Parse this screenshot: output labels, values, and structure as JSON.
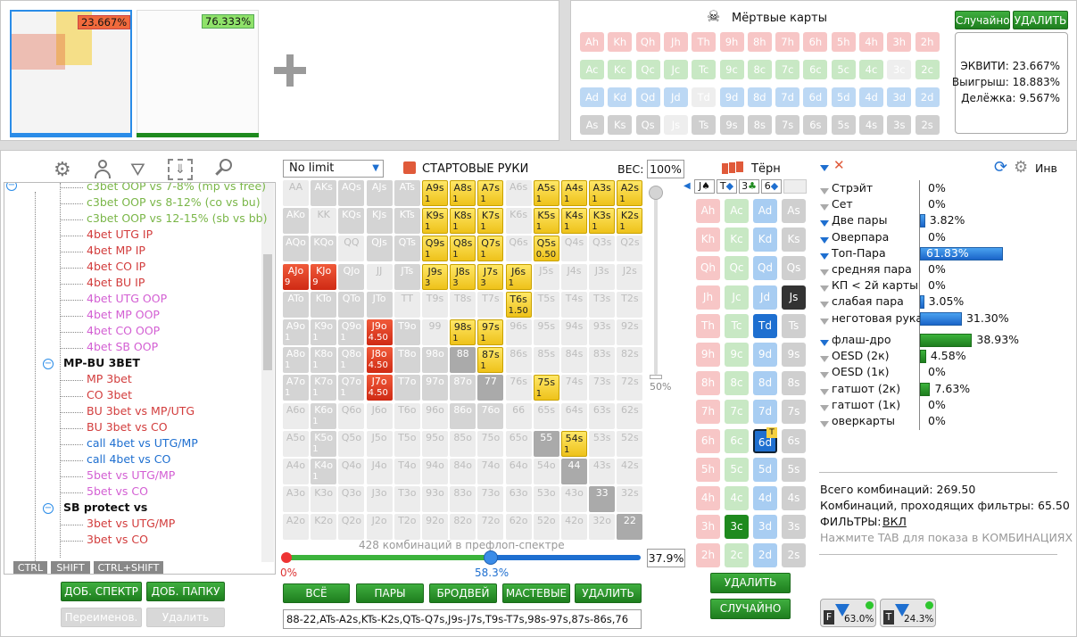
{
  "top": {
    "thumb1_pct": "23.667%",
    "thumb2_pct": "76.333%",
    "dead_title": "Мёртвые карты",
    "random": "Случайно",
    "delete": "УДАЛИТЬ",
    "equity": "ЭКВИТИ: 23.667%",
    "win": "Выигрыш: 18.883%",
    "tie": "Делёжка: 9.567%",
    "rows": [
      [
        "Ah",
        "Kh",
        "Qh",
        "Jh",
        "Th",
        "9h",
        "8h",
        "7h",
        "6h",
        "5h",
        "4h",
        "3h",
        "2h"
      ],
      [
        "Ac",
        "Kc",
        "Qc",
        "Jc",
        "Tc",
        "9c",
        "8c",
        "7c",
        "6c",
        "5c",
        "4c",
        "3c",
        "2c"
      ],
      [
        "Ad",
        "Kd",
        "Qd",
        "Jd",
        "Td",
        "9d",
        "8d",
        "7d",
        "6d",
        "5d",
        "4d",
        "3d",
        "2d"
      ],
      [
        "As",
        "Ks",
        "Qs",
        "Js",
        "Ts",
        "9s",
        "8s",
        "7s",
        "6s",
        "5s",
        "4s",
        "3s",
        "2s"
      ]
    ]
  },
  "tree": {
    "items": [
      {
        "t": "c3bet OOP vs 7-8% (mp vs free)",
        "c": "#7ab648",
        "lvl": 2
      },
      {
        "t": "c3bet OOP vs 8-12% (co vs bu)",
        "c": "#7ab648",
        "lvl": 2
      },
      {
        "t": "c3bet OOP vs 12-15% (sb vs bb)",
        "c": "#7ab648",
        "lvl": 2
      },
      {
        "t": "4bet UTG IP",
        "c": "#d23c3c",
        "lvl": 2
      },
      {
        "t": "4bet MP IP",
        "c": "#d23c3c",
        "lvl": 2
      },
      {
        "t": "4bet CO IP",
        "c": "#d23c3c",
        "lvl": 2
      },
      {
        "t": "4bet BU IP",
        "c": "#d23c3c",
        "lvl": 2
      },
      {
        "t": "4bet UTG OOP",
        "c": "#d35fd3",
        "lvl": 2
      },
      {
        "t": "4bet MP OOP",
        "c": "#d35fd3",
        "lvl": 2
      },
      {
        "t": "4bet CO OOP",
        "c": "#d35fd3",
        "lvl": 2
      },
      {
        "t": "4bet SB OOP",
        "c": "#d35fd3",
        "lvl": 2
      },
      {
        "t": "MP-BU 3BET",
        "c": "#111",
        "lvl": 1
      },
      {
        "t": "MP 3bet",
        "c": "#d23c3c",
        "lvl": 2
      },
      {
        "t": "CO 3bet",
        "c": "#d23c3c",
        "lvl": 2
      },
      {
        "t": "BU 3bet vs MP/UTG",
        "c": "#d23c3c",
        "lvl": 2
      },
      {
        "t": "BU 3bet vs CO",
        "c": "#d23c3c",
        "lvl": 2
      },
      {
        "t": "call 4bet vs UTG/MP",
        "c": "#1e6fd0",
        "lvl": 2
      },
      {
        "t": "call 4bet vs CO",
        "c": "#1e6fd0",
        "lvl": 2
      },
      {
        "t": "5bet vs UTG/MP",
        "c": "#d35fd3",
        "lvl": 2
      },
      {
        "t": "5bet vs CO",
        "c": "#d35fd3",
        "lvl": 2
      },
      {
        "t": "SB protect vs",
        "c": "#111",
        "lvl": 1
      },
      {
        "t": "3bet vs UTG/MP",
        "c": "#d23c3c",
        "lvl": 2
      },
      {
        "t": "3bet vs CO",
        "c": "#d23c3c",
        "lvl": 2
      }
    ],
    "keys": [
      "CTRL",
      "SHIFT",
      "CTRL+SHIFT"
    ],
    "add_spectrum": "ДОБ. СПЕКТР",
    "add_folder": "ДОБ. ПАПКУ",
    "rename": "Переименов.",
    "remove": "Удалить"
  },
  "matrix": {
    "mode": "No limit",
    "title": "СТАРТОВЫЕ РУКИ",
    "weight_label": "ВЕС:",
    "weight": "100%",
    "slider_pct": "50%",
    "combos_text": "428 комбинаций в префлоп-спектре",
    "range_left": "0%",
    "range_mid": "58.3%",
    "range_right": "37.9%",
    "btn_all": "ВСЁ",
    "btn_pairs": "ПАРЫ",
    "btn_bw": "БРОДВЕЙ",
    "btn_suited": "МАСТЕВЫЕ",
    "btn_del": "УДАЛИТЬ",
    "range_string": "88-22,ATs-A2s,KTs-K2s,QTs-Q7s,J9s-J7s,T9s-T7s,98s-97s,87s-86s,76"
  },
  "turn": {
    "title": "Тёрн",
    "delete": "УДАЛИТЬ",
    "random": "СЛУЧАЙНО"
  },
  "stats": {
    "inv": "Инв",
    "rows": [
      {
        "n": "Стрэйт",
        "v": "0%",
        "w": 0,
        "f": 0
      },
      {
        "n": "Сет",
        "v": "0%",
        "w": 0,
        "f": 0
      },
      {
        "n": "Две пары",
        "v": "3.82%",
        "w": 3.82,
        "f": 1
      },
      {
        "n": "Оверпара",
        "v": "0%",
        "w": 0,
        "f": 1
      },
      {
        "n": "Топ-Пара",
        "v": "61.83%",
        "w": 61.83,
        "f": 1
      },
      {
        "n": "средняя пара",
        "v": "0%",
        "w": 0,
        "f": 0
      },
      {
        "n": "КП < 2й карты",
        "v": "0%",
        "w": 0,
        "f": 0
      },
      {
        "n": "слабая пара",
        "v": "3.05%",
        "w": 3.05,
        "f": 0
      },
      {
        "n": "неготовая рука",
        "v": "31.30%",
        "w": 31.3,
        "f": 0
      }
    ],
    "draws": [
      {
        "n": "флаш-дро",
        "v": "38.93%",
        "w": 38.93,
        "f": 1
      },
      {
        "n": "OESD (2к)",
        "v": "4.58%",
        "w": 4.58,
        "f": 0
      },
      {
        "n": "OESD (1к)",
        "v": "0%",
        "w": 0,
        "f": 0
      },
      {
        "n": "гатшот (2к)",
        "v": "7.63%",
        "w": 7.63,
        "f": 0
      },
      {
        "n": "гатшот (1к)",
        "v": "0%",
        "w": 0,
        "f": 0
      },
      {
        "n": "оверкарты",
        "v": "0%",
        "w": 0,
        "f": 0
      }
    ],
    "total": "Всего комбинаций: 269.50",
    "pass": "Комбинаций, проходящих фильтры: 65.50",
    "filters_label": "ФИЛЬТРЫ:",
    "filters_val": "ВКЛ",
    "hint": "Нажмите TAB для показа в КОМБИНАЦИЯХ",
    "f_pct": "63.0%",
    "t_pct": "24.3%"
  }
}
